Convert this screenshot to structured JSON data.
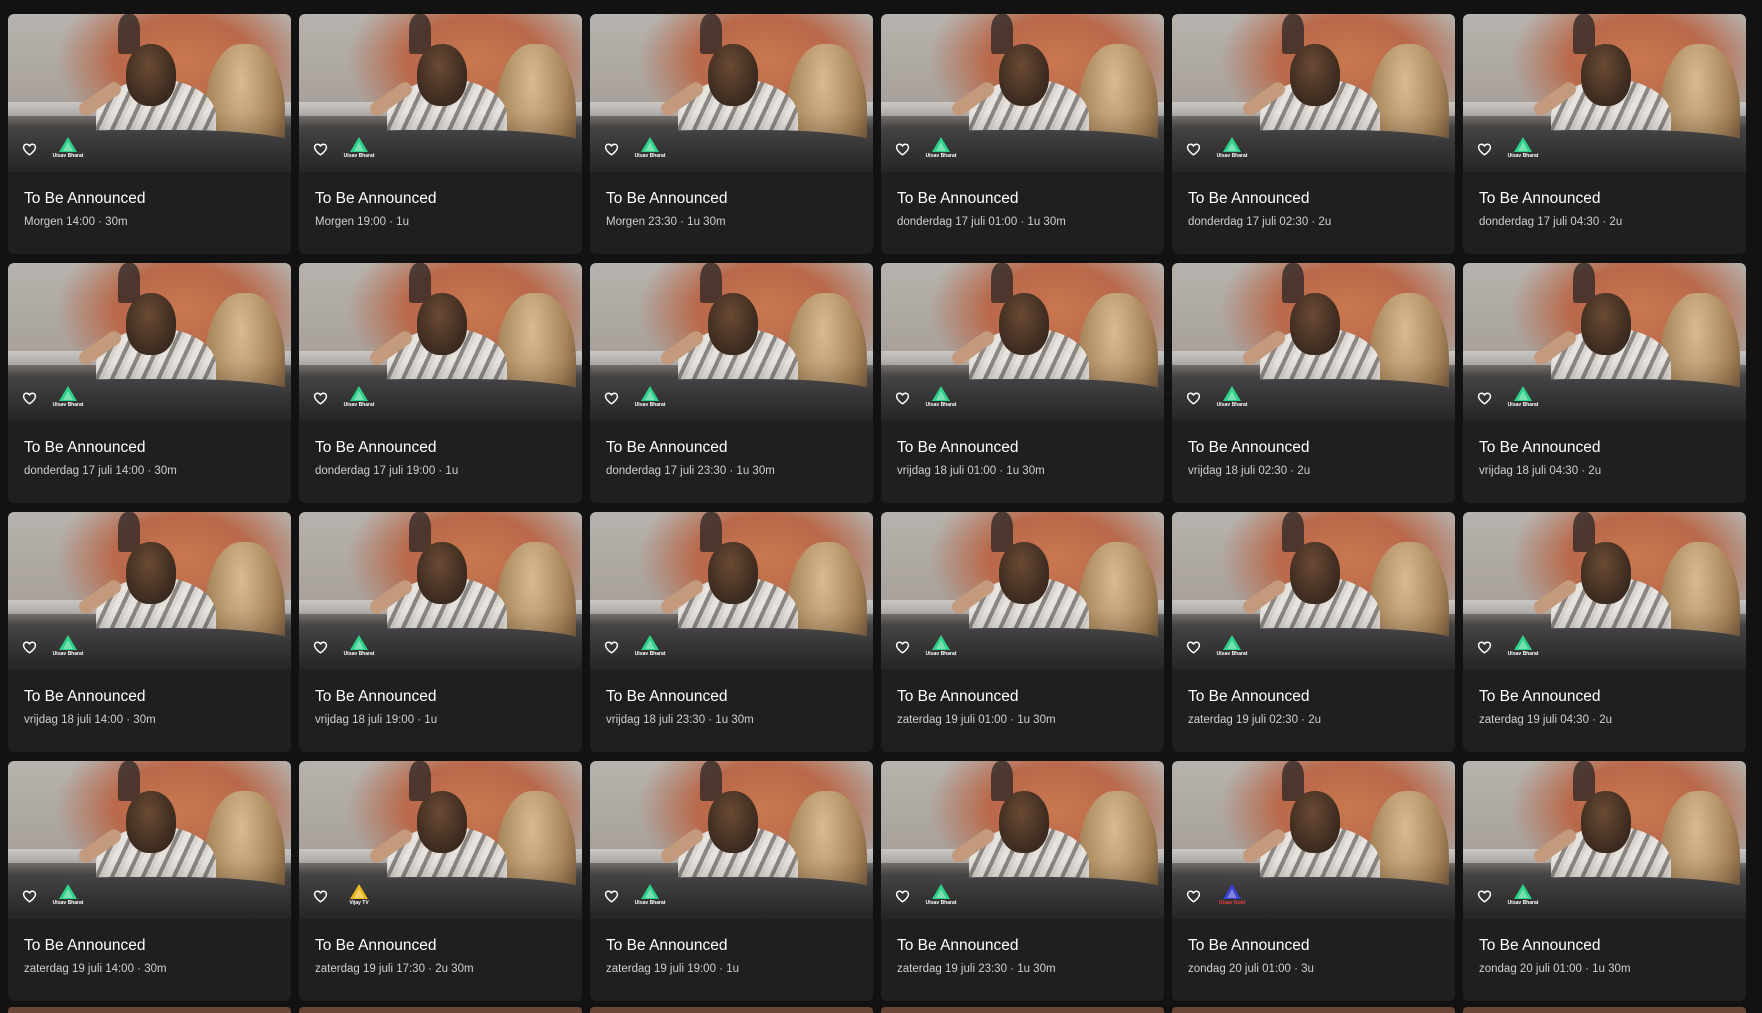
{
  "cards": [
    {
      "title": "To Be Announced",
      "meta": "Morgen 14:00 · 30m",
      "channel": "Utsav Bharat",
      "logo_color": "#2fd18a"
    },
    {
      "title": "To Be Announced",
      "meta": "Morgen 19:00 · 1u",
      "channel": "Utsav Bharat",
      "logo_color": "#2fd18a"
    },
    {
      "title": "To Be Announced",
      "meta": "Morgen 23:30 · 1u 30m",
      "channel": "Utsav Bharat",
      "logo_color": "#2fd18a"
    },
    {
      "title": "To Be Announced",
      "meta": "donderdag 17 juli 01:00 · 1u 30m",
      "channel": "Utsav Bharat",
      "logo_color": "#2fd18a"
    },
    {
      "title": "To Be Announced",
      "meta": "donderdag 17 juli 02:30 · 2u",
      "channel": "Utsav Bharat",
      "logo_color": "#2fd18a"
    },
    {
      "title": "To Be Announced",
      "meta": "donderdag 17 juli 04:30 · 2u",
      "channel": "Utsav Bharat",
      "logo_color": "#2fd18a"
    },
    {
      "title": "To Be Announced",
      "meta": "donderdag 17 juli 14:00 · 30m",
      "channel": "Utsav Bharat",
      "logo_color": "#2fd18a"
    },
    {
      "title": "To Be Announced",
      "meta": "donderdag 17 juli 19:00 · 1u",
      "channel": "Utsav Bharat",
      "logo_color": "#2fd18a"
    },
    {
      "title": "To Be Announced",
      "meta": "donderdag 17 juli 23:30 · 1u 30m",
      "channel": "Utsav Bharat",
      "logo_color": "#2fd18a"
    },
    {
      "title": "To Be Announced",
      "meta": "vrijdag 18 juli 01:00 · 1u 30m",
      "channel": "Utsav Bharat",
      "logo_color": "#2fd18a"
    },
    {
      "title": "To Be Announced",
      "meta": "vrijdag 18 juli 02:30 · 2u",
      "channel": "Utsav Bharat",
      "logo_color": "#2fd18a"
    },
    {
      "title": "To Be Announced",
      "meta": "vrijdag 18 juli 04:30 · 2u",
      "channel": "Utsav Bharat",
      "logo_color": "#2fd18a"
    },
    {
      "title": "To Be Announced",
      "meta": "vrijdag 18 juli 14:00 · 30m",
      "channel": "Utsav Bharat",
      "logo_color": "#2fd18a"
    },
    {
      "title": "To Be Announced",
      "meta": "vrijdag 18 juli 19:00 · 1u",
      "channel": "Utsav Bharat",
      "logo_color": "#2fd18a"
    },
    {
      "title": "To Be Announced",
      "meta": "vrijdag 18 juli 23:30 · 1u 30m",
      "channel": "Utsav Bharat",
      "logo_color": "#2fd18a"
    },
    {
      "title": "To Be Announced",
      "meta": "zaterdag 19 juli 01:00 · 1u 30m",
      "channel": "Utsav Bharat",
      "logo_color": "#2fd18a"
    },
    {
      "title": "To Be Announced",
      "meta": "zaterdag 19 juli 02:30 · 2u",
      "channel": "Utsav Bharat",
      "logo_color": "#2fd18a"
    },
    {
      "title": "To Be Announced",
      "meta": "zaterdag 19 juli 04:30 · 2u",
      "channel": "Utsav Bharat",
      "logo_color": "#2fd18a"
    },
    {
      "title": "To Be Announced",
      "meta": "zaterdag 19 juli 14:00 · 30m",
      "channel": "Utsav Bharat",
      "logo_color": "#2fd18a"
    },
    {
      "title": "To Be Announced",
      "meta": "zaterdag 19 juli 17:30 · 2u 30m",
      "channel": "Vijay TV",
      "logo_color": "#e8b81c"
    },
    {
      "title": "To Be Announced",
      "meta": "zaterdag 19 juli 19:00 · 1u",
      "channel": "Utsav Bharat",
      "logo_color": "#2fd18a"
    },
    {
      "title": "To Be Announced",
      "meta": "zaterdag 19 juli 23:30 · 1u 30m",
      "channel": "Utsav Bharat",
      "logo_color": "#2fd18a"
    },
    {
      "title": "To Be Announced",
      "meta": "zondag 20 juli 01:00 · 3u",
      "channel": "Utsav Gold",
      "logo_color": "#3a3fd1"
    },
    {
      "title": "To Be Announced",
      "meta": "zondag 20 juli 01:00 · 1u 30m",
      "channel": "Utsav Bharat",
      "logo_color": "#2fd18a"
    }
  ],
  "colors": {
    "background": "#121212",
    "card": "#1f1f1f",
    "title": "#ffffff",
    "meta": "#cfcfcf"
  },
  "icons": {
    "favorite": "heart-outline-icon",
    "channel": "channel-logo-icon"
  }
}
